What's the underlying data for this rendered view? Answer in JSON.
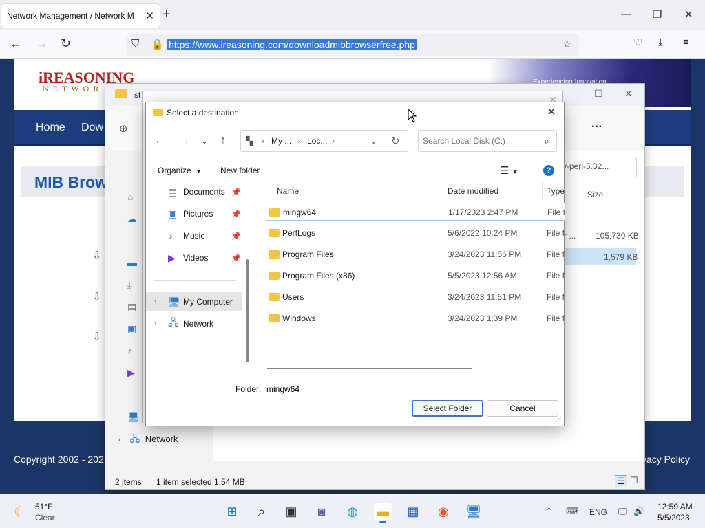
{
  "browser": {
    "tab_title": "Network Management / Network M",
    "url": "https://www.ireasoning.com/downloadmibbrowserfree.php"
  },
  "website": {
    "logo_line1": "iREASONING",
    "logo_line2": "NETWOR",
    "banner_tag": "Experiencing Innovation",
    "nav": [
      "Home",
      "Dow"
    ],
    "heading": "MIB Brow",
    "copyright": "Copyright 2002 - 202",
    "privacy": "vacy Policy"
  },
  "explorer": {
    "title_fragment": "st",
    "search_fragment": "y-perl-5.32...",
    "size_header": "Size",
    "frag_r": "r ...",
    "sizes": [
      "105,739 KB",
      "1,579 KB"
    ],
    "network_label": "Network",
    "status": {
      "items": "2 items",
      "selected": "1 item selected",
      "size": "1.54 MB"
    }
  },
  "dialog": {
    "title": "Select a destination",
    "breadcrumb": [
      "My ...",
      "Loc..."
    ],
    "search_placeholder": "Search Local Disk (C:)",
    "organize": "Organize",
    "new_folder": "New folder",
    "help": "?",
    "quick_access": [
      {
        "label": "Documents",
        "icon": "document-icon"
      },
      {
        "label": "Pictures",
        "icon": "pictures-icon"
      },
      {
        "label": "Music",
        "icon": "music-icon"
      },
      {
        "label": "Videos",
        "icon": "videos-icon"
      }
    ],
    "tree": [
      {
        "label": "My Computer",
        "selected": true
      },
      {
        "label": "Network",
        "selected": false
      }
    ],
    "columns": {
      "name": "Name",
      "date": "Date modified",
      "type": "Type"
    },
    "files": [
      {
        "name": "mingw64",
        "date": "1/17/2023 2:47 PM",
        "type": "File fo",
        "selected": true
      },
      {
        "name": "PerfLogs",
        "date": "5/6/2022 10:24 PM",
        "type": "File fo",
        "selected": false
      },
      {
        "name": "Program Files",
        "date": "3/24/2023 11:56 PM",
        "type": "File fo",
        "selected": false
      },
      {
        "name": "Program Files (x86)",
        "date": "5/5/2023 12:56 AM",
        "type": "File fo",
        "selected": false
      },
      {
        "name": "Users",
        "date": "3/24/2023 11:51 PM",
        "type": "File fo",
        "selected": false
      },
      {
        "name": "Windows",
        "date": "3/24/2023 1:39 PM",
        "type": "File fo",
        "selected": false
      }
    ],
    "folder_label": "Folder:",
    "folder_value": "mingw64",
    "select_button": "Select Folder",
    "cancel_button": "Cancel"
  },
  "taskbar": {
    "temperature": "51°F",
    "condition": "Clear",
    "language": "ENG",
    "time": "12:59 AM",
    "date": "5/5/2023"
  },
  "colors": {
    "accent": "#1a73d2",
    "site_nav": "#1d3d7e",
    "folder": "#f4c542",
    "url_selection": "#3778d0"
  }
}
